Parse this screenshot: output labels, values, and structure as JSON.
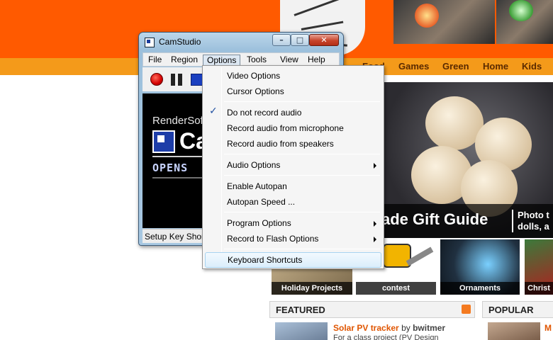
{
  "website": {
    "nav": [
      "Food",
      "Games",
      "Green",
      "Home",
      "Kids"
    ],
    "hero": {
      "title": "ade Gift Guide",
      "side_line1": "Photo t",
      "side_line2": "dolls, a"
    },
    "thumbs": [
      "Holiday Projects",
      "contest",
      "Ornaments",
      "Christ"
    ],
    "featured": {
      "header": "FEATURED",
      "title": "Solar PV tracker",
      "by": "by",
      "author": "bwitmer",
      "desc": "For a class project (PV Design"
    },
    "popular": {
      "header": "POPULAR",
      "title": "M"
    }
  },
  "window": {
    "title": "CamStudio",
    "controls": {
      "minimize": "–",
      "maximize": "□",
      "close": "✕"
    },
    "menu": [
      "File",
      "Region",
      "Options",
      "Tools",
      "View",
      "Help"
    ],
    "active_menu": "Options",
    "toolbar": {
      "record": "record-icon",
      "pause": "pause-icon",
      "stop": "stop-icon"
    },
    "display": {
      "brand": "RenderSof",
      "big": "Ca",
      "sub": "OPENS"
    },
    "status": "Setup Key Short"
  },
  "dropdown": {
    "items": [
      {
        "label": "Video Options"
      },
      {
        "label": "Cursor Options"
      },
      {
        "label": "Do not record audio",
        "checked": true,
        "check": "✓"
      },
      {
        "label": "Record audio from microphone"
      },
      {
        "label": "Record audio from speakers"
      },
      {
        "label": "Audio Options",
        "submenu": true
      },
      {
        "label": "Enable Autopan"
      },
      {
        "label": "Autopan Speed ..."
      },
      {
        "label": "Program Options",
        "submenu": true
      },
      {
        "label": "Record to Flash Options",
        "submenu": true
      },
      {
        "label": "Keyboard Shortcuts",
        "hover": true
      }
    ]
  }
}
